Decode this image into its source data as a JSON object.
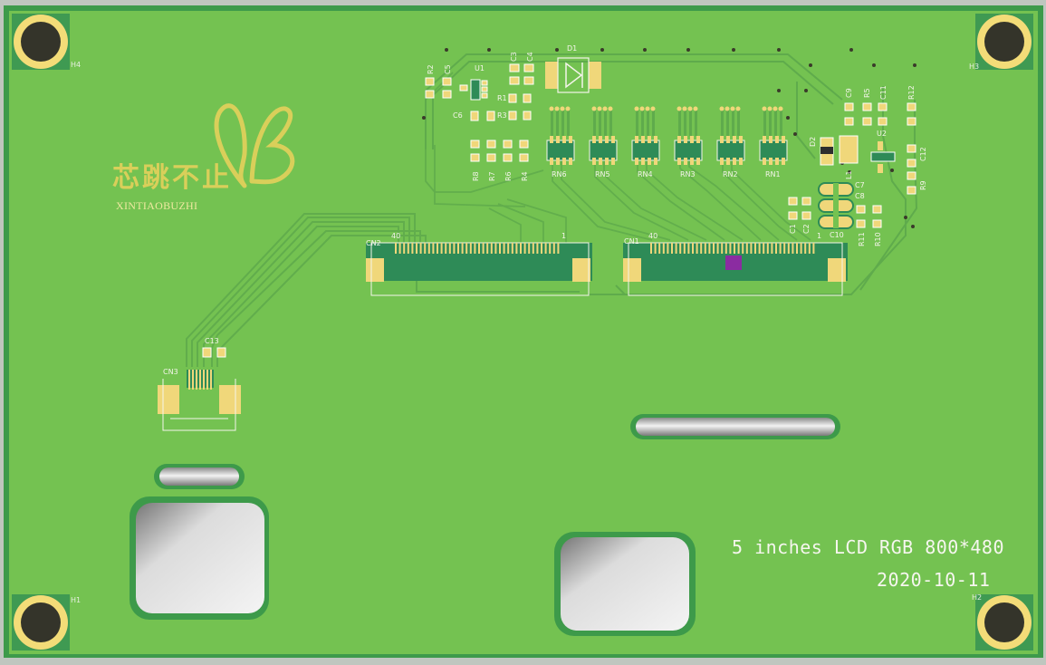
{
  "board": {
    "title_line": "5 inches LCD RGB 800*480",
    "date_line": "2020-10-11",
    "logo": {
      "chinese": "芯跳不止",
      "latin": "XINTIAOBUZHI"
    },
    "mount_holes": [
      "H1",
      "H2",
      "H3",
      "H4"
    ]
  },
  "connectors": {
    "cn1": {
      "ref": "CN1",
      "pin_last": "40",
      "pin_first": "1"
    },
    "cn2": {
      "ref": "CN2",
      "pin_last": "40",
      "pin_first": "1"
    },
    "cn3": {
      "ref": "CN3"
    }
  },
  "resistor_networks": [
    "RN6",
    "RN5",
    "RN4",
    "RN3",
    "RN2",
    "RN1"
  ],
  "components": {
    "left_cluster": [
      "R2",
      "C5",
      "U1",
      "C3",
      "C4",
      "D1",
      "R1",
      "R3",
      "C6"
    ],
    "resistors_row": [
      "R8",
      "R7",
      "R6",
      "R4"
    ],
    "right_cluster": [
      "C9",
      "R5",
      "C11",
      "R12",
      "D2",
      "U2",
      "C12",
      "L1",
      "R9",
      "C7",
      "C8",
      "C1",
      "C2",
      "C10",
      "R11",
      "R10"
    ],
    "cn3_cap": "C13"
  },
  "colors": {
    "board": "#74c251",
    "board_edge": "#3d9a4a",
    "copper_pad": "#f0d77a",
    "connector_body": "#2e8b57",
    "silkscreen": "#f4f4ea",
    "trace": "#5ea84a",
    "logo": "#d9cf5a"
  }
}
